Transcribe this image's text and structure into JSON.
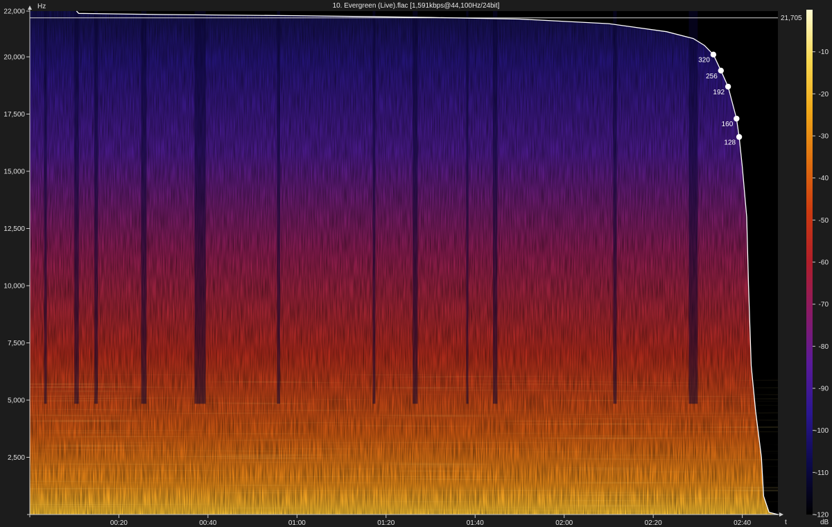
{
  "header": {
    "title": "10. Evergreen  (Live).flac [1,591kbps@44,100Hz/24bit]",
    "y_unit": "Hz",
    "x_unit": "t",
    "colorbar_unit": "dB"
  },
  "chart_data": {
    "type": "heatmap",
    "title": "10. Evergreen  (Live).flac [1,591kbps@44,100Hz/24bit]",
    "xlabel": "t",
    "ylabel": "Hz",
    "x_range_seconds": [
      0,
      168
    ],
    "ylim": [
      0,
      22000
    ],
    "y_ticks": [
      {
        "value": 2500,
        "label": "2,500"
      },
      {
        "value": 5000,
        "label": "5,000"
      },
      {
        "value": 7500,
        "label": "7,500"
      },
      {
        "value": 10000,
        "label": "10,000"
      },
      {
        "value": 12500,
        "label": "12,500"
      },
      {
        "value": 15000,
        "label": "15,000"
      },
      {
        "value": 17500,
        "label": "17,500"
      },
      {
        "value": 20000,
        "label": "20,000"
      },
      {
        "value": 22000,
        "label": "22,000"
      }
    ],
    "x_ticks": [
      {
        "value": 20,
        "label": "00:20"
      },
      {
        "value": 40,
        "label": "00:40"
      },
      {
        "value": 60,
        "label": "01:00"
      },
      {
        "value": 80,
        "label": "01:20"
      },
      {
        "value": 100,
        "label": "01:40"
      },
      {
        "value": 120,
        "label": "02:00"
      },
      {
        "value": 140,
        "label": "02:20"
      },
      {
        "value": 160,
        "label": "02:40"
      }
    ],
    "cutoff_line": {
      "value": 21705,
      "label": "21,705"
    },
    "bitrate_markers": [
      {
        "label": "320",
        "t": 153.5,
        "hz": 20100
      },
      {
        "label": "256",
        "t": 155.2,
        "hz": 19400
      },
      {
        "label": "192",
        "t": 156.8,
        "hz": 18700
      },
      {
        "label": "160",
        "t": 158.7,
        "hz": 17300
      },
      {
        "label": "128",
        "t": 159.3,
        "hz": 16500
      }
    ],
    "cutoff_curve": [
      {
        "t": 10.5,
        "hz": 22000
      },
      {
        "t": 11,
        "hz": 21900
      },
      {
        "t": 30,
        "hz": 21850
      },
      {
        "t": 60,
        "hz": 21800
      },
      {
        "t": 90,
        "hz": 21720
      },
      {
        "t": 110,
        "hz": 21650
      },
      {
        "t": 130,
        "hz": 21450
      },
      {
        "t": 143,
        "hz": 21100
      },
      {
        "t": 149,
        "hz": 20800
      },
      {
        "t": 151.5,
        "hz": 20500
      },
      {
        "t": 153.5,
        "hz": 20100
      },
      {
        "t": 155.2,
        "hz": 19400
      },
      {
        "t": 156.8,
        "hz": 18700
      },
      {
        "t": 158.7,
        "hz": 17300
      },
      {
        "t": 159.3,
        "hz": 16500
      },
      {
        "t": 160,
        "hz": 15200
      },
      {
        "t": 161,
        "hz": 13000
      },
      {
        "t": 161.4,
        "hz": 10000
      },
      {
        "t": 162,
        "hz": 6500
      },
      {
        "t": 163,
        "hz": 4500
      },
      {
        "t": 164.3,
        "hz": 2500
      },
      {
        "t": 164.8,
        "hz": 800
      },
      {
        "t": 166,
        "hz": 100
      },
      {
        "t": 168,
        "hz": 0
      }
    ],
    "colorbar": {
      "range": [
        -120,
        0
      ],
      "ticks": [
        {
          "value": -10,
          "label": "-10"
        },
        {
          "value": -20,
          "label": "-20"
        },
        {
          "value": -30,
          "label": "-30"
        },
        {
          "value": -40,
          "label": "-40"
        },
        {
          "value": -50,
          "label": "-50"
        },
        {
          "value": -60,
          "label": "-60"
        },
        {
          "value": -70,
          "label": "-70"
        },
        {
          "value": -80,
          "label": "-80"
        },
        {
          "value": -90,
          "label": "-90"
        },
        {
          "value": -100,
          "label": "-100"
        },
        {
          "value": -110,
          "label": "-110"
        },
        {
          "value": -120,
          "label": "-120"
        }
      ],
      "colors": [
        "#000000",
        "#0c0a4a",
        "#2a1690",
        "#5a1a9a",
        "#8a1a66",
        "#b01e2a",
        "#cc3a10",
        "#e07010",
        "#f0a818",
        "#f8d850",
        "#fffbd0"
      ]
    },
    "colors": {
      "background": "#1c1c1c",
      "curve": "#ffffff",
      "axis": "#cfcfcf"
    }
  }
}
